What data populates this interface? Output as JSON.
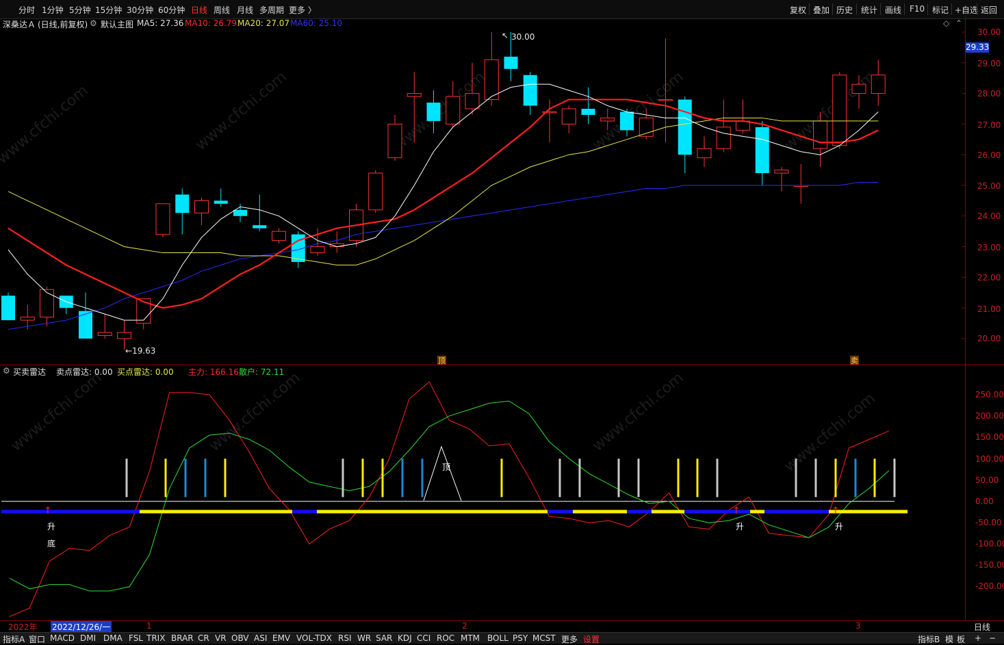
{
  "toolbar": {
    "periods": [
      "分时",
      "1分钟",
      "5分钟",
      "15分钟",
      "30分钟",
      "60分钟",
      "日线",
      "周线",
      "月线",
      "多周期",
      "更多 〉"
    ],
    "active_period": "日线",
    "tools": [
      "复权",
      "叠加",
      "历史",
      "统计",
      "画线",
      "F10",
      "标记",
      "+自选",
      "返回"
    ]
  },
  "main_header": {
    "stock": "深桑达Ａ",
    "mode": "(日线,前复权)",
    "template": "默认主图",
    "ma5": "MA5: 27.36",
    "ma10": "MA10: 26.79",
    "ma20": "MA20: 27.07",
    "ma60": "MA60: 25.10"
  },
  "price_axis": [
    "30.00",
    "29.00",
    "28.00",
    "27.00",
    "26.00",
    "25.00",
    "24.00",
    "23.00",
    "22.00",
    "21.00",
    "20.00"
  ],
  "current_price": "29.33",
  "annotations": {
    "high": "30.00",
    "low": "←19.63",
    "top_mark": "顶",
    "sell_mark": "卖"
  },
  "indicator_header": {
    "name": "买卖雷达",
    "sell": "卖点雷达: 0.00",
    "buy": "买点雷达: 0.00",
    "main": "主力: 166.16",
    "retail": "散户: 72.11"
  },
  "indicator_axis": [
    "250.00",
    "200.00",
    "150.00",
    "100.00",
    "50.00",
    "0.00",
    "-50.00",
    "-100.00",
    "-150.00",
    "-200.00"
  ],
  "indicator_marks": {
    "rise": "升",
    "bottom": "底",
    "top": "顶"
  },
  "date_axis": {
    "year": "2022年",
    "cursor_date": "2022/12/26/一",
    "m1": "1",
    "m2": "2",
    "m3": "3",
    "period": "日线"
  },
  "tabs": [
    "指标A",
    "窗口",
    "MACD",
    "DMI",
    "DMA",
    "FSL",
    "TRIX",
    "BRAR",
    "CR",
    "VR",
    "OBV",
    "ASI",
    "EMV",
    "VOL-TDX",
    "RSI",
    "WR",
    "SAR",
    "KDJ",
    "CCI",
    "ROC",
    "MTM",
    "BOLL",
    "PSY",
    "MCST",
    "更多",
    "设置"
  ],
  "tabs_right": [
    "指标B",
    "模",
    "板"
  ],
  "watermark": "www.cfchi.com",
  "colors": {
    "up": "#ff3333",
    "down": "#00e5ff",
    "ma5": "#ffffff",
    "ma10": "#ff2020",
    "ma20": "#e8e84a",
    "ma60": "#2a2aff",
    "axis": "#8b0000"
  },
  "chart_data": [
    {
      "type": "candlestick",
      "title": "深桑达Ａ 日线 前复权",
      "ylim": [
        19.5,
        30.2
      ],
      "candles": [
        {
          "o": 21.4,
          "h": 21.5,
          "l": 20.6,
          "c": 20.6
        },
        {
          "o": 20.6,
          "h": 21.1,
          "l": 20.3,
          "c": 20.7
        },
        {
          "o": 20.7,
          "h": 21.7,
          "l": 20.4,
          "c": 21.6
        },
        {
          "o": 21.4,
          "h": 21.4,
          "l": 20.8,
          "c": 21.0
        },
        {
          "o": 20.9,
          "h": 21.5,
          "l": 20.0,
          "c": 20.0
        },
        {
          "o": 20.1,
          "h": 20.8,
          "l": 20.0,
          "c": 20.2
        },
        {
          "o": 20.0,
          "h": 20.6,
          "l": 19.63,
          "c": 20.2
        },
        {
          "o": 20.5,
          "h": 21.3,
          "l": 20.3,
          "c": 21.3
        },
        {
          "o": 23.4,
          "h": 24.4,
          "l": 23.3,
          "c": 24.4
        },
        {
          "o": 24.7,
          "h": 24.9,
          "l": 23.4,
          "c": 24.1
        },
        {
          "o": 24.1,
          "h": 24.6,
          "l": 23.7,
          "c": 24.5
        },
        {
          "o": 24.5,
          "h": 24.9,
          "l": 24.3,
          "c": 24.4
        },
        {
          "o": 24.2,
          "h": 24.4,
          "l": 23.8,
          "c": 24.0
        },
        {
          "o": 23.7,
          "h": 24.7,
          "l": 23.5,
          "c": 23.6
        },
        {
          "o": 23.2,
          "h": 23.6,
          "l": 23.1,
          "c": 23.5
        },
        {
          "o": 23.4,
          "h": 23.5,
          "l": 22.3,
          "c": 22.5
        },
        {
          "o": 22.8,
          "h": 23.6,
          "l": 22.7,
          "c": 23.0
        },
        {
          "o": 23.0,
          "h": 23.5,
          "l": 22.8,
          "c": 23.1
        },
        {
          "o": 23.2,
          "h": 24.4,
          "l": 23.0,
          "c": 24.2
        },
        {
          "o": 24.2,
          "h": 25.5,
          "l": 24.1,
          "c": 25.4
        },
        {
          "o": 25.9,
          "h": 27.3,
          "l": 25.8,
          "c": 27.0
        },
        {
          "o": 27.9,
          "h": 28.7,
          "l": 26.4,
          "c": 28.0
        },
        {
          "o": 27.7,
          "h": 28.1,
          "l": 26.7,
          "c": 27.1
        },
        {
          "o": 27.0,
          "h": 28.4,
          "l": 26.9,
          "c": 27.9
        },
        {
          "o": 27.5,
          "h": 29.0,
          "l": 27.3,
          "c": 28.0
        },
        {
          "o": 27.8,
          "h": 30.0,
          "l": 27.6,
          "c": 29.1
        },
        {
          "o": 29.2,
          "h": 30.0,
          "l": 28.4,
          "c": 28.8
        },
        {
          "o": 28.6,
          "h": 28.7,
          "l": 27.3,
          "c": 27.6
        },
        {
          "o": 27.4,
          "h": 27.8,
          "l": 26.4,
          "c": 27.4
        },
        {
          "o": 27.0,
          "h": 27.6,
          "l": 26.7,
          "c": 27.5
        },
        {
          "o": 27.5,
          "h": 28.2,
          "l": 27.0,
          "c": 27.3
        },
        {
          "o": 27.1,
          "h": 27.5,
          "l": 26.8,
          "c": 27.2
        },
        {
          "o": 27.4,
          "h": 27.5,
          "l": 26.6,
          "c": 26.8
        },
        {
          "o": 26.6,
          "h": 27.5,
          "l": 26.5,
          "c": 27.2
        },
        {
          "o": 27.8,
          "h": 29.8,
          "l": 26.4,
          "c": 27.8
        },
        {
          "o": 27.8,
          "h": 27.9,
          "l": 25.4,
          "c": 26.0
        },
        {
          "o": 25.9,
          "h": 26.6,
          "l": 25.6,
          "c": 26.2
        },
        {
          "o": 26.2,
          "h": 27.8,
          "l": 26.1,
          "c": 26.9
        },
        {
          "o": 26.8,
          "h": 27.8,
          "l": 26.7,
          "c": 27.1
        },
        {
          "o": 26.9,
          "h": 27.1,
          "l": 25.0,
          "c": 25.4
        },
        {
          "o": 25.4,
          "h": 25.6,
          "l": 24.8,
          "c": 25.5
        },
        {
          "o": 25.0,
          "h": 25.7,
          "l": 24.4,
          "c": 25.0
        },
        {
          "o": 26.2,
          "h": 27.4,
          "l": 25.6,
          "c": 27.1
        },
        {
          "o": 26.3,
          "h": 28.7,
          "l": 26.2,
          "c": 28.6
        },
        {
          "o": 28.0,
          "h": 28.6,
          "l": 27.5,
          "c": 28.3
        },
        {
          "o": 28.0,
          "h": 29.1,
          "l": 27.6,
          "c": 28.6
        }
      ],
      "ma5": [
        22.9,
        22.1,
        21.5,
        21.2,
        21.0,
        20.8,
        20.6,
        20.6,
        21.3,
        22.4,
        23.3,
        23.9,
        24.3,
        24.2,
        24.0,
        23.6,
        23.2,
        23.0,
        23.1,
        23.3,
        24.0,
        25.0,
        26.1,
        26.9,
        27.4,
        27.9,
        28.2,
        28.3,
        28.3,
        28.1,
        27.9,
        27.6,
        27.4,
        27.3,
        27.2,
        27.2,
        26.9,
        26.7,
        26.6,
        26.5,
        26.3,
        26.1,
        26.0,
        26.3,
        26.8,
        27.4
      ],
      "ma10": [
        23.6,
        23.2,
        22.8,
        22.4,
        22.1,
        21.8,
        21.5,
        21.2,
        21.0,
        21.1,
        21.3,
        21.7,
        22.1,
        22.4,
        22.8,
        23.2,
        23.4,
        23.6,
        23.7,
        23.8,
        23.9,
        24.2,
        24.6,
        25.0,
        25.4,
        25.9,
        26.4,
        26.9,
        27.5,
        27.8,
        27.8,
        27.8,
        27.8,
        27.7,
        27.6,
        27.4,
        27.2,
        27.1,
        27.1,
        27.0,
        26.8,
        26.6,
        26.4,
        26.4,
        26.5,
        26.8
      ],
      "ma20": [
        24.8,
        24.5,
        24.2,
        23.9,
        23.6,
        23.3,
        23.0,
        22.9,
        22.8,
        22.8,
        22.8,
        22.8,
        22.7,
        22.7,
        22.7,
        22.6,
        22.5,
        22.4,
        22.4,
        22.6,
        22.9,
        23.2,
        23.6,
        24.0,
        24.5,
        25.0,
        25.3,
        25.6,
        25.8,
        26.0,
        26.1,
        26.3,
        26.5,
        26.7,
        26.9,
        27.0,
        27.1,
        27.2,
        27.2,
        27.2,
        27.1,
        27.1,
        27.1,
        27.1,
        27.1,
        27.1
      ],
      "ma60": [
        20.3,
        20.4,
        20.5,
        20.6,
        20.8,
        21.0,
        21.3,
        21.5,
        21.7,
        21.9,
        22.2,
        22.4,
        22.6,
        22.7,
        22.8,
        22.9,
        23.1,
        23.2,
        23.4,
        23.5,
        23.6,
        23.7,
        23.8,
        23.9,
        24.0,
        24.1,
        24.2,
        24.3,
        24.4,
        24.5,
        24.6,
        24.7,
        24.8,
        24.9,
        24.9,
        25.0,
        25.0,
        25.0,
        25.0,
        25.0,
        25.0,
        25.0,
        25.0,
        25.0,
        25.1,
        25.1
      ]
    },
    {
      "type": "line",
      "title": "买卖雷达",
      "ylim": [
        -270,
        290
      ],
      "series": [
        {
          "name": "主力",
          "values": [
            -270,
            -250,
            -140,
            -110,
            -115,
            -80,
            -60,
            70,
            255,
            255,
            250,
            190,
            115,
            30,
            -20,
            -100,
            -65,
            -45,
            10,
            100,
            240,
            280,
            190,
            170,
            130,
            135,
            55,
            -35,
            -40,
            -50,
            -45,
            -60,
            -25,
            20,
            -60,
            -65,
            -20,
            10,
            -75,
            -80,
            -85,
            -30,
            125,
            145,
            165
          ]
        },
        {
          "name": "散户",
          "values": [
            -180,
            -205,
            -195,
            -195,
            -210,
            -210,
            -200,
            -125,
            30,
            125,
            155,
            160,
            145,
            120,
            80,
            45,
            35,
            25,
            35,
            70,
            120,
            175,
            200,
            215,
            230,
            235,
            205,
            140,
            100,
            65,
            40,
            15,
            -5,
            0,
            -40,
            -50,
            -45,
            -30,
            -55,
            -70,
            -85,
            -60,
            -5,
            30,
            72
          ]
        }
      ]
    }
  ]
}
